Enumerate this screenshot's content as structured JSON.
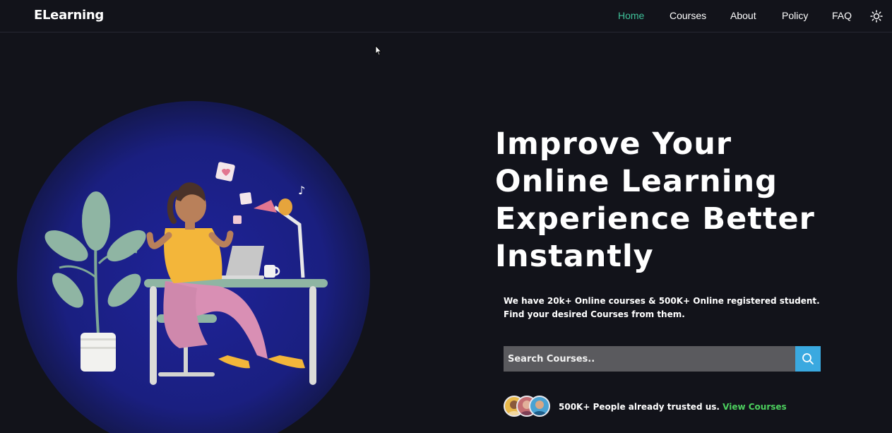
{
  "brand": {
    "name": "ELearning"
  },
  "nav": {
    "items": [
      {
        "label": "Home",
        "active": true
      },
      {
        "label": "Courses",
        "active": false
      },
      {
        "label": "About",
        "active": false
      },
      {
        "label": "Policy",
        "active": false
      },
      {
        "label": "FAQ",
        "active": false
      }
    ],
    "theme_toggle_icon": "sun-icon"
  },
  "hero": {
    "title": "Improve Your Online Learning Experience Better Instantly",
    "description": "We have 20k+ Online courses & 500K+ Online registered student. Find your desired Courses from them.",
    "search": {
      "placeholder": "Search Courses..",
      "button_icon": "search-icon"
    },
    "trust": {
      "text": "500K+ People already trusted us.",
      "link_label": "View Courses"
    }
  },
  "colors": {
    "background": "#12131a",
    "accent_green": "#3fc29a",
    "link_green": "#4ccf5e",
    "search_button": "#3aa9e0",
    "search_field": "#5a5a5e",
    "circle": "#1b1f77"
  }
}
